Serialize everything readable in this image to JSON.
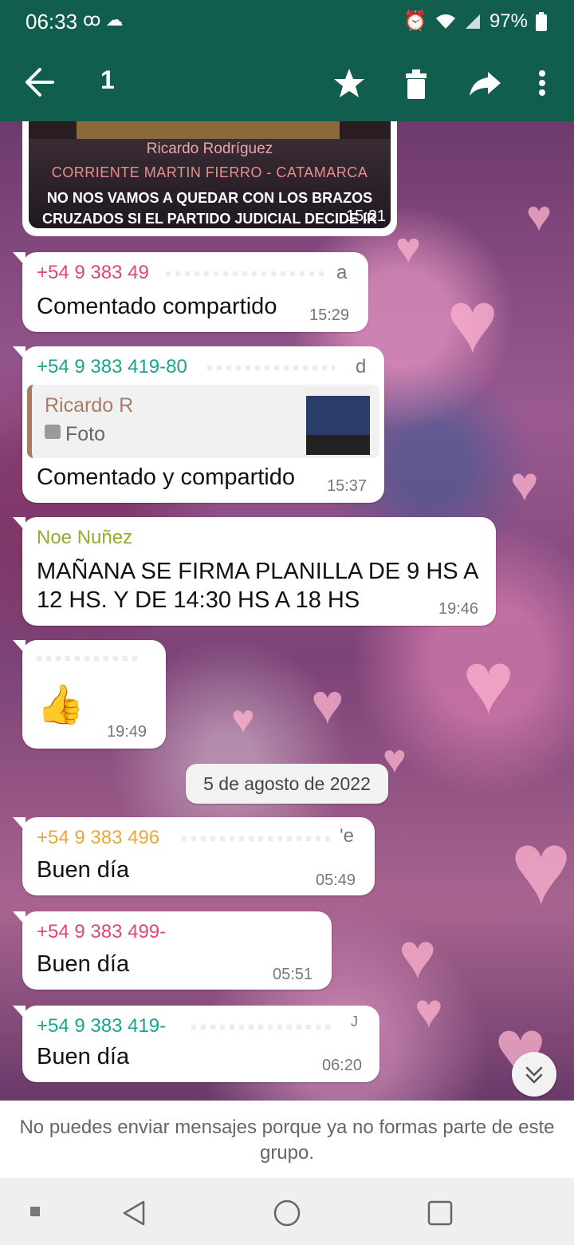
{
  "status_bar": {
    "time": "06:33",
    "battery": "97%"
  },
  "app_bar": {
    "selected_count": "1"
  },
  "messages": [
    {
      "type": "image",
      "poster_lines": [
        "Ricardo Rodríguez",
        "CORRIENTE MARTIN FIERRO - CATAMARCA",
        "NO NOS VAMOS A QUEDAR CON LOS BRAZOS",
        "CRUZADOS SI EL PARTIDO JUDICIAL DECIDE IR"
      ],
      "time": "15:21"
    },
    {
      "sender": "+54 9 383 49",
      "sender_tail": "a",
      "sender_color": "#e0457b",
      "text": "Comentado compartido",
      "time": "15:29"
    },
    {
      "sender": "+54 9 383 419-80",
      "sender_tail": "d",
      "sender_color": "#1aa58a",
      "quote_name": "Ricardo R",
      "quote_text": "Foto",
      "text": "Comentado y compartido",
      "time": "15:37"
    },
    {
      "sender": "Noe Nuñez",
      "sender_color": "#9aa92e",
      "text_lines": [
        "MAÑANA SE FIRMA PLANILLA DE 9 HS A",
        "12 HS. Y DE 14:30 HS A 18 HS"
      ],
      "time": "19:46"
    },
    {
      "text": "👍",
      "time": "19:49"
    },
    {
      "sender": "+54 9 383 496",
      "sender_tail": "'e",
      "sender_color": "#e6a93a",
      "text": "Buen día",
      "time": "05:49"
    },
    {
      "sender": "+54 9 383 499-",
      "sender_color": "#e0457b",
      "text": "Buen  día",
      "time": "05:51"
    },
    {
      "sender": "+54 9 383 419-",
      "sender_tail": "J",
      "sender_color": "#1aa58a",
      "text": "Buen día",
      "time": "06:20"
    }
  ],
  "date_divider": "5 de agosto de 2022",
  "footer_notice": "No puedes enviar mensajes porque ya no formas parte de este grupo.",
  "colors": {
    "header": "#115e4e",
    "pink_sender": "#e0457b",
    "teal_sender": "#1aa58a",
    "olive_sender": "#9aa92e",
    "orange_sender": "#e6a93a"
  }
}
